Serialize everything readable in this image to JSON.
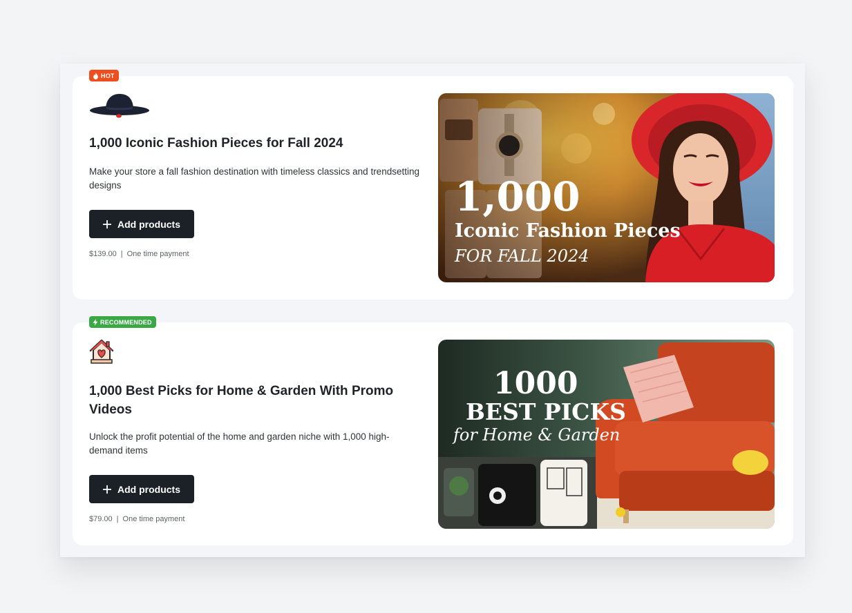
{
  "cards": [
    {
      "badge": "HOT",
      "title": "1,000 Iconic Fashion Pieces for Fall 2024",
      "description": "Make your store a fall fashion destination with timeless classics and trendsetting designs",
      "button_label": "Add products",
      "price": "$139.00",
      "separator": "|",
      "payment": "One time payment",
      "banner": {
        "line1": "1,000",
        "line2": "Iconic Fashion Pieces",
        "line3": "FOR FALL 2024"
      }
    },
    {
      "badge": "RECOMMENDED",
      "title": "1,000 Best Picks for Home & Garden With Promo Videos",
      "description": "Unlock the profit potential of the home and garden niche with 1,000 high-demand items",
      "button_label": "Add products",
      "price": "$79.00",
      "separator": "|",
      "payment": "One time payment",
      "banner": {
        "line1": "1000",
        "line2": "BEST PICKS",
        "line3": "for Home & Garden"
      }
    }
  ],
  "colors": {
    "hot_badge": "#ee4d1e",
    "recommended_badge": "#3aa845",
    "button_bg": "#1c2128"
  }
}
